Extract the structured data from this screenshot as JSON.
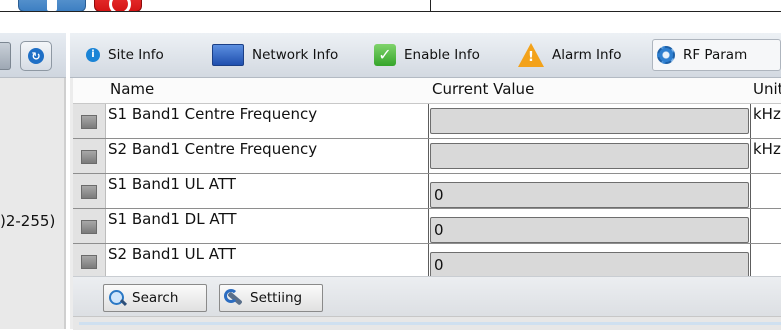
{
  "left_panel": {
    "partial_label": ")2-255)"
  },
  "tabs": [
    {
      "label": "Site Info",
      "icon": "info-icon"
    },
    {
      "label": "Network Info",
      "icon": "monitor-icon"
    },
    {
      "label": "Enable Info",
      "icon": "checkmark-icon"
    },
    {
      "label": "Alarm Info",
      "icon": "warning-icon"
    },
    {
      "label": "RF Param",
      "icon": "gear-icon",
      "active": true
    }
  ],
  "grid": {
    "columns": [
      "Name",
      "Current Value",
      "Unit"
    ],
    "rows": [
      {
        "name": "S1 Band1 Centre Frequency",
        "value": "",
        "unit": "kHz"
      },
      {
        "name": "S2 Band1 Centre Frequency",
        "value": "",
        "unit": "kHz"
      },
      {
        "name": "S1 Band1 UL ATT",
        "value": "0",
        "unit": ""
      },
      {
        "name": "S1 Band1 DL ATT",
        "value": "0",
        "unit": ""
      },
      {
        "name": "S2 Band1 UL ATT",
        "value": "0",
        "unit": ""
      }
    ]
  },
  "toolbar": {
    "search_label": "Search",
    "setting_label": "Settiing"
  },
  "colors": {
    "tab_bar_top": "#edf1f5",
    "tab_bar_bottom": "#d3d9e1",
    "value_box_fill": "#d9d9d9",
    "row_selector": "#e2e2e2"
  }
}
